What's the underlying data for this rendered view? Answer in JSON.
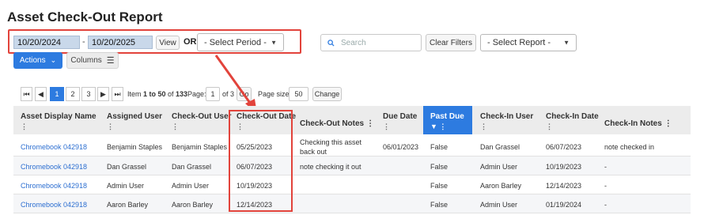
{
  "page_title": "Asset Check-Out Report",
  "filters": {
    "date_from": "10/20/2024",
    "date_separator": "-",
    "date_to": "10/20/2025",
    "view_label": "View",
    "or_label": "OR",
    "period_select": "- Select Period -",
    "search_placeholder": "Search",
    "clear_filters_label": "Clear Filters",
    "report_select": "- Select Report -"
  },
  "toolbar": {
    "actions_label": "Actions",
    "columns_label": "Columns"
  },
  "pager": {
    "pages": [
      "1",
      "2",
      "3"
    ],
    "item_prefix": "Item ",
    "item_range": "1 to 50",
    "item_of": " of ",
    "item_total": "133",
    "page_label": "Page:",
    "page_value": "1",
    "page_of": "of 3",
    "go_label": "Go",
    "page_size_label": "Page size:",
    "page_size_value": "50",
    "change_label": "Change"
  },
  "table": {
    "columns": {
      "asset": "Asset Display Name",
      "assigned": "Assigned User",
      "checkout_user": "Check-Out User",
      "checkout_date": "Check-Out Date",
      "checkout_notes": "Check-Out Notes",
      "due_date": "Due Date",
      "past_due": "Past Due",
      "checkin_user": "Check-In User",
      "checkin_date": "Check-In Date",
      "checkin_notes": "Check-In Notes"
    },
    "rows": [
      {
        "asset": "Chromebook 042918",
        "assigned": "Benjamin Staples",
        "checkout_user": "Benjamin Staples",
        "checkout_date": "05/25/2023",
        "notes1": "Checking this asset",
        "notes2": "back out",
        "due": "06/01/2023",
        "past_due": "False",
        "checkin_user": "Dan Grassel",
        "checkin_date": "06/07/2023",
        "checkin_notes": "note checked in"
      },
      {
        "asset": "Chromebook 042918",
        "assigned": "Dan Grassel",
        "checkout_user": "Dan Grassel",
        "checkout_date": "06/07/2023",
        "notes1": "note checking it out",
        "notes2": "",
        "due": "",
        "past_due": "False",
        "checkin_user": "Admin User",
        "checkin_date": "10/19/2023",
        "checkin_notes": "-"
      },
      {
        "asset": "Chromebook 042918",
        "assigned": "Admin User",
        "checkout_user": "Admin User",
        "checkout_date": "10/19/2023",
        "notes1": "",
        "notes2": "",
        "due": "",
        "past_due": "False",
        "checkin_user": "Aaron Barley",
        "checkin_date": "12/14/2023",
        "checkin_notes": "-"
      },
      {
        "asset": "Chromebook 042918",
        "assigned": "Aaron Barley",
        "checkout_user": "Aaron Barley",
        "checkout_date": "12/14/2023",
        "notes1": "",
        "notes2": "",
        "due": "",
        "past_due": "False",
        "checkin_user": "Admin User",
        "checkin_date": "01/19/2024",
        "checkin_notes": "-"
      }
    ]
  },
  "colors": {
    "accent": "#2d7be0",
    "annotation_red": "#e2433b",
    "link": "#2d6fd1"
  }
}
